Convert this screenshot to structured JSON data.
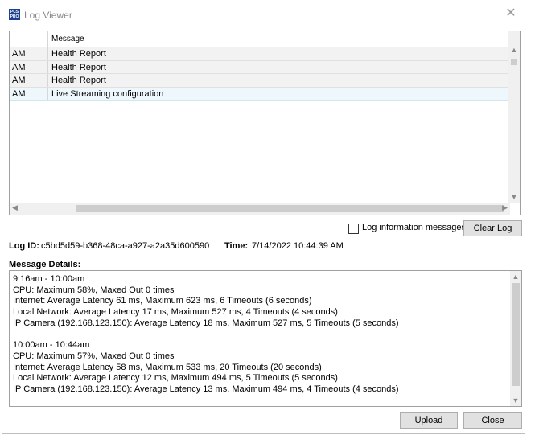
{
  "window": {
    "title": "Log Viewer",
    "icon_text": "PCS PRO"
  },
  "grid": {
    "columns": [
      "",
      "Message"
    ],
    "rows": [
      {
        "time": "AM",
        "message": "Health Report",
        "selected": false
      },
      {
        "time": "AM",
        "message": "Health Report",
        "selected": false
      },
      {
        "time": "AM",
        "message": "Health Report",
        "selected": false
      },
      {
        "time": "AM",
        "message": "Live Streaming configuration",
        "selected": true
      }
    ]
  },
  "options": {
    "log_info_label": "Log information messages",
    "log_info_checked": false
  },
  "buttons": {
    "clear_log": "Clear Log",
    "upload": "Upload",
    "close": "Close"
  },
  "info": {
    "log_id_label": "Log ID:",
    "log_id_value": "c5bd5d59-b368-48ca-a927-a2a35d600590",
    "time_label": "Time:",
    "time_value": "7/14/2022 10:44:39 AM"
  },
  "details": {
    "label": "Message Details:",
    "lines": [
      "9:16am - 10:00am",
      "CPU: Maximum 58%, Maxed Out 0 times",
      "Internet: Average Latency 61 ms, Maximum 623 ms, 6 Timeouts (6 seconds)",
      "Local Network: Average Latency 17 ms, Maximum 527 ms, 4 Timeouts (4 seconds)",
      "IP Camera (192.168.123.150): Average Latency 18 ms, Maximum 527 ms, 5 Timeouts (5 seconds)",
      "",
      "10:00am - 10:44am",
      "CPU: Maximum 57%, Maxed Out 0 times",
      "Internet: Average Latency 58 ms, Maximum 533 ms, 20 Timeouts (20 seconds)",
      "Local Network: Average Latency 12 ms, Maximum 494 ms, 5 Timeouts (5 seconds)",
      "IP Camera (192.168.123.150): Average Latency 13 ms, Maximum 494 ms, 4 Timeouts (4 seconds)"
    ]
  }
}
